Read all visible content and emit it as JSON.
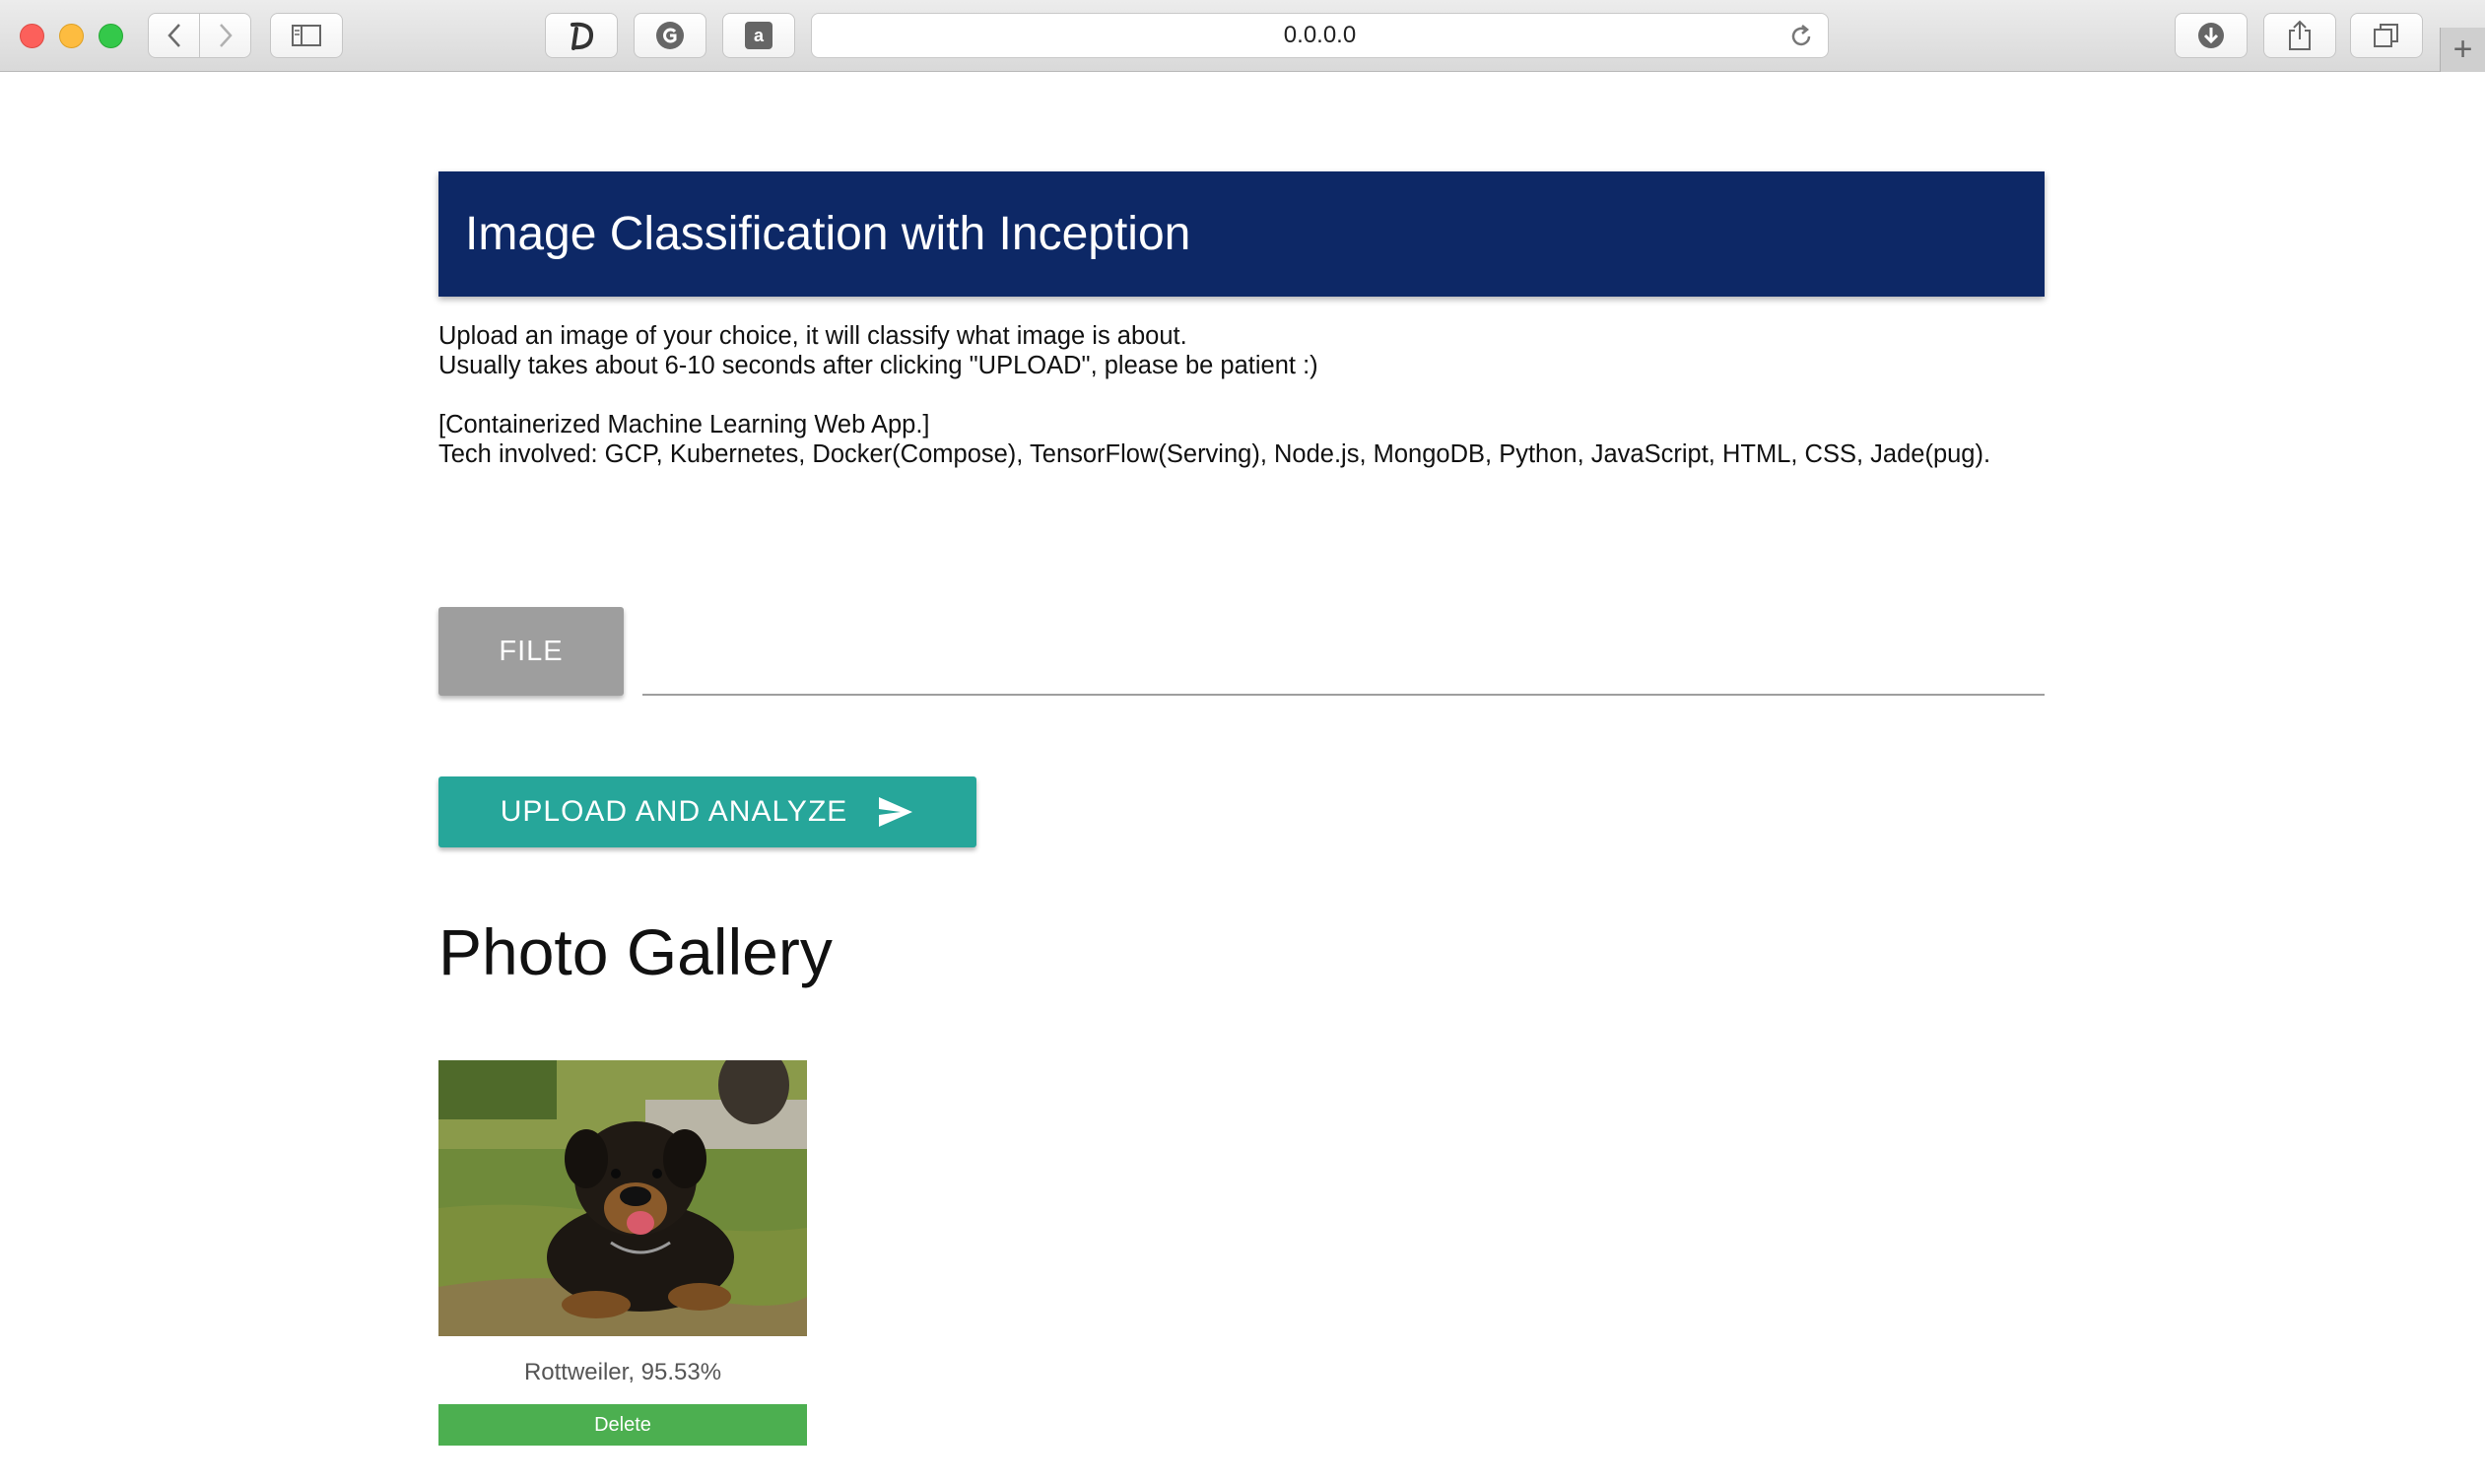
{
  "browser": {
    "url": "0.0.0.0",
    "extensions": [
      "dashlane-icon",
      "grammarly-icon",
      "amazon-icon"
    ],
    "new_tab_symbol": "+"
  },
  "header": {
    "title": "Image Classification with Inception"
  },
  "description": {
    "line1": "Upload an image of your choice, it will classify what image is about.",
    "line2": "Usually takes about 6-10 seconds after clicking \"UPLOAD\", please be patient :)",
    "line3": "[Containerized Machine Learning Web App.]",
    "line4": "Tech involved: GCP, Kubernetes, Docker(Compose), TensorFlow(Serving), Node.js, MongoDB, Python, JavaScript, HTML, CSS, Jade(pug)."
  },
  "upload_form": {
    "file_button_label": "FILE",
    "file_path_value": "",
    "upload_button_label": "UPLOAD AND ANALYZE",
    "upload_icon": "send-icon"
  },
  "gallery": {
    "title": "Photo Gallery",
    "items": [
      {
        "caption": "Rottweiler, 95.53%",
        "delete_label": "Delete"
      }
    ]
  },
  "colors": {
    "header_bg": "#0d2866",
    "file_button_bg": "#9e9e9e",
    "upload_button_bg": "#26a69a",
    "delete_button_bg": "#4caf50"
  }
}
